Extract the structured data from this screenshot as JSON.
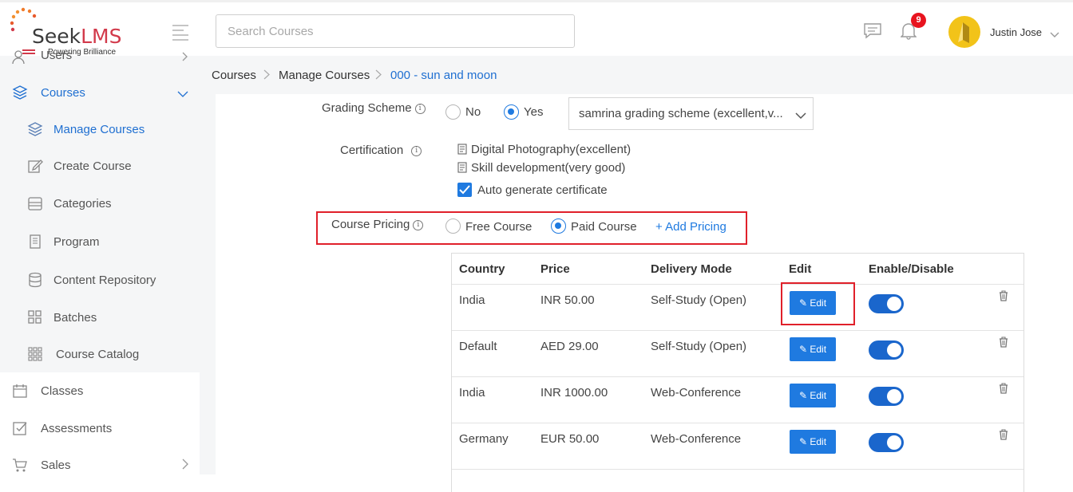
{
  "brand": {
    "name_main": "Seek",
    "name_accent": "LMS",
    "tagline": "Powering Brilliance"
  },
  "header": {
    "search_placeholder": "Search Courses",
    "notification_count": "9",
    "user_name": "Justin Jose",
    "icons": [
      "chat-icon",
      "bell-icon",
      "chevron-down-icon"
    ]
  },
  "sidebar": {
    "items": [
      {
        "label": "Users",
        "icon": "users-icon"
      },
      {
        "label": "Courses",
        "icon": "layers-icon"
      },
      {
        "label": "Manage Courses",
        "icon": "layers-icon"
      },
      {
        "label": "Create Course",
        "icon": "edit-icon"
      },
      {
        "label": "Categories",
        "icon": "folder-icon"
      },
      {
        "label": "Program",
        "icon": "document-icon"
      },
      {
        "label": "Content Repository",
        "icon": "database-icon"
      },
      {
        "label": "Batches",
        "icon": "grid-icon"
      },
      {
        "label": "Course Catalog",
        "icon": "catalog-icon"
      },
      {
        "label": "Classes",
        "icon": "calendar-icon"
      },
      {
        "label": "Assessments",
        "icon": "checklist-icon"
      },
      {
        "label": "Sales",
        "icon": "cart-icon"
      }
    ]
  },
  "breadcrumb": [
    "Courses",
    "Manage Courses",
    "000 - sun and moon"
  ],
  "form": {
    "grading_label": "Grading Scheme",
    "grading_no": "No",
    "grading_yes": "Yes",
    "grading_selected": "samrina grading scheme (excellent,v...",
    "certification_label": "Certification",
    "certificates": [
      "Digital Photography(excellent)",
      "Skill development(very good)"
    ],
    "auto_generate": "Auto generate certificate",
    "pricing_label": "Course Pricing",
    "pricing_free": "Free Course",
    "pricing_paid": "Paid Course",
    "add_pricing": "+ Add Pricing"
  },
  "pricing_table": {
    "headers": [
      "Country",
      "Price",
      "Delivery Mode",
      "Edit",
      "Enable/Disable"
    ],
    "edit_label": "Edit",
    "rows": [
      {
        "country": "India",
        "price": "INR 50.00",
        "mode": "Self-Study (Open)",
        "enabled": true
      },
      {
        "country": "Default",
        "price": "AED 29.00",
        "mode": "Self-Study (Open)",
        "enabled": true
      },
      {
        "country": "India",
        "price": "INR 1000.00",
        "mode": "Web-Conference",
        "enabled": true
      },
      {
        "country": "Germany",
        "price": "EUR 50.00",
        "mode": "Web-Conference",
        "enabled": true
      }
    ]
  },
  "colors": {
    "accent": "#1f7ae0",
    "highlight_box": "#e0202a",
    "badge": "#e8141f"
  }
}
